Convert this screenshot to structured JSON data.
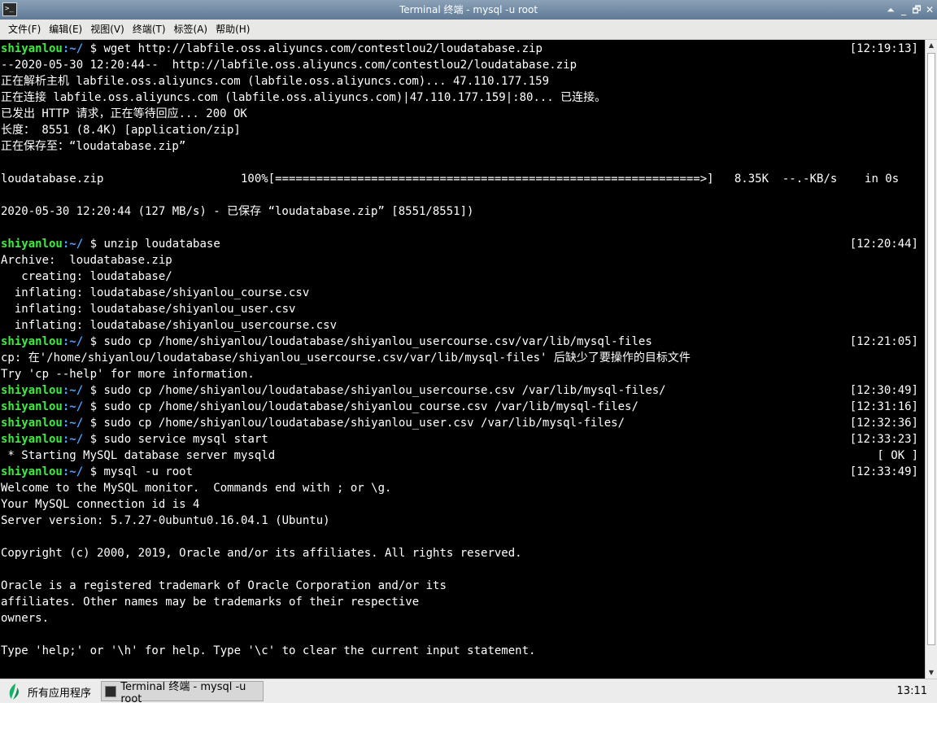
{
  "window": {
    "title": "Terminal 终端 - mysql -u root",
    "controls": [
      "⏶",
      "_",
      "🗗",
      "✕"
    ]
  },
  "menu": [
    "文件(F)",
    "编辑(E)",
    "视图(V)",
    "终端(T)",
    "标签(A)",
    "帮助(H)"
  ],
  "prompt": {
    "user": "shiyanlou",
    "path": ":~/",
    "symbol": " $ "
  },
  "terminal_lines": [
    {
      "prompt": true,
      "text": "wget http://labfile.oss.aliyuncs.com/contestlou2/loudatabase.zip",
      "ts": "[12:19:13]"
    },
    {
      "text": "--2020-05-30 12:20:44--  http://labfile.oss.aliyuncs.com/contestlou2/loudatabase.zip"
    },
    {
      "text": "正在解析主机 labfile.oss.aliyuncs.com (labfile.oss.aliyuncs.com)... 47.110.177.159"
    },
    {
      "text": "正在连接 labfile.oss.aliyuncs.com (labfile.oss.aliyuncs.com)|47.110.177.159|:80... 已连接。"
    },
    {
      "text": "已发出 HTTP 请求，正在等待回应... 200 OK"
    },
    {
      "text": "长度： 8551 (8.4K) [application/zip]"
    },
    {
      "text": "正在保存至：“loudatabase.zip”"
    },
    {
      "text": ""
    },
    {
      "text": "loudatabase.zip                    100%[==============================================================>]   8.35K  --.-KB/s    in 0s"
    },
    {
      "text": ""
    },
    {
      "text": "2020-05-30 12:20:44 (127 MB/s) - 已保存 “loudatabase.zip” [8551/8551])"
    },
    {
      "text": ""
    },
    {
      "prompt": true,
      "text": "unzip loudatabase",
      "ts": "[12:20:44]"
    },
    {
      "text": "Archive:  loudatabase.zip"
    },
    {
      "text": "   creating: loudatabase/"
    },
    {
      "text": "  inflating: loudatabase/shiyanlou_course.csv"
    },
    {
      "text": "  inflating: loudatabase/shiyanlou_user.csv"
    },
    {
      "text": "  inflating: loudatabase/shiyanlou_usercourse.csv"
    },
    {
      "prompt": true,
      "text": "sudo cp /home/shiyanlou/loudatabase/shiyanlou_usercourse.csv/var/lib/mysql-files",
      "ts": "[12:21:05]"
    },
    {
      "text": "cp: 在'/home/shiyanlou/loudatabase/shiyanlou_usercourse.csv/var/lib/mysql-files' 后缺少了要操作的目标文件"
    },
    {
      "text": "Try 'cp --help' for more information."
    },
    {
      "prompt": true,
      "text": "sudo cp /home/shiyanlou/loudatabase/shiyanlou_usercourse.csv /var/lib/mysql-files/",
      "ts": "[12:30:49]"
    },
    {
      "prompt": true,
      "text": "sudo cp /home/shiyanlou/loudatabase/shiyanlou_course.csv /var/lib/mysql-files/",
      "ts": "[12:31:16]"
    },
    {
      "prompt": true,
      "text": "sudo cp /home/shiyanlou/loudatabase/shiyanlou_user.csv /var/lib/mysql-files/",
      "ts": "[12:32:36]"
    },
    {
      "prompt": true,
      "text": "sudo service mysql start",
      "ts": "[12:33:23]"
    },
    {
      "text": " * Starting MySQL database server mysqld",
      "ts": "[ OK ]"
    },
    {
      "prompt": true,
      "text": "mysql -u root",
      "ts": "[12:33:49]"
    },
    {
      "text": "Welcome to the MySQL monitor.  Commands end with ; or \\g."
    },
    {
      "text": "Your MySQL connection id is 4"
    },
    {
      "text": "Server version: 5.7.27-0ubuntu0.16.04.1 (Ubuntu)"
    },
    {
      "text": ""
    },
    {
      "text": "Copyright (c) 2000, 2019, Oracle and/or its affiliates. All rights reserved."
    },
    {
      "text": ""
    },
    {
      "text": "Oracle is a registered trademark of Oracle Corporation and/or its"
    },
    {
      "text": "affiliates. Other names may be trademarks of their respective"
    },
    {
      "text": "owners."
    },
    {
      "text": ""
    },
    {
      "text": "Type 'help;' or '\\h' for help. Type '\\c' to clear the current input statement."
    }
  ],
  "taskbar": {
    "start_label": "所有应用程序",
    "task_label": "Terminal 终端 - mysql -u root",
    "clock": "13:11"
  },
  "colors": {
    "prompt_user": "#3aef3a",
    "prompt_path": "#4ea5ff",
    "terminal_bg": "#000000",
    "terminal_fg": "#ffffff"
  }
}
